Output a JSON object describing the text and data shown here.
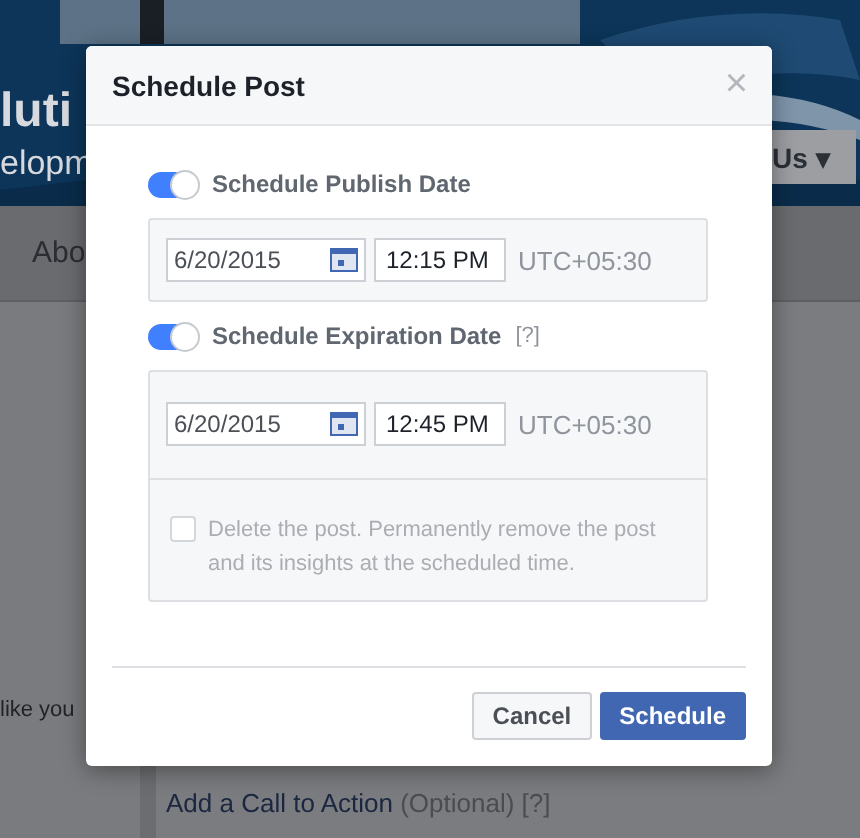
{
  "background": {
    "page_title": "luti",
    "page_subtitle": "elopm",
    "contact_button": {
      "label": "Us",
      "caret": "▾"
    },
    "nav_item": "Abo",
    "snippet": "like you",
    "call_to_action": {
      "label": "Add a Call to Action",
      "optional": "(Optional)",
      "help": "[?]"
    }
  },
  "dialog": {
    "title": "Schedule Post",
    "close": "×",
    "sections": [
      {
        "label": "Schedule Publish Date",
        "on": true,
        "date": "6/20/2015",
        "time": "12:15 PM",
        "timezone": "UTC+05:30"
      },
      {
        "label": "Schedule Expiration Date",
        "help": "[?]",
        "on": true,
        "date": "6/20/2015",
        "time": "12:45 PM",
        "timezone": "UTC+05:30",
        "option": {
          "text": "Delete the post. Permanently remove the post and its insights at the scheduled time.",
          "checked": false,
          "disabled": true
        }
      }
    ],
    "buttons": [
      {
        "label": "Cancel",
        "kind": "secondary"
      },
      {
        "label": "Schedule",
        "kind": "primary"
      }
    ]
  }
}
